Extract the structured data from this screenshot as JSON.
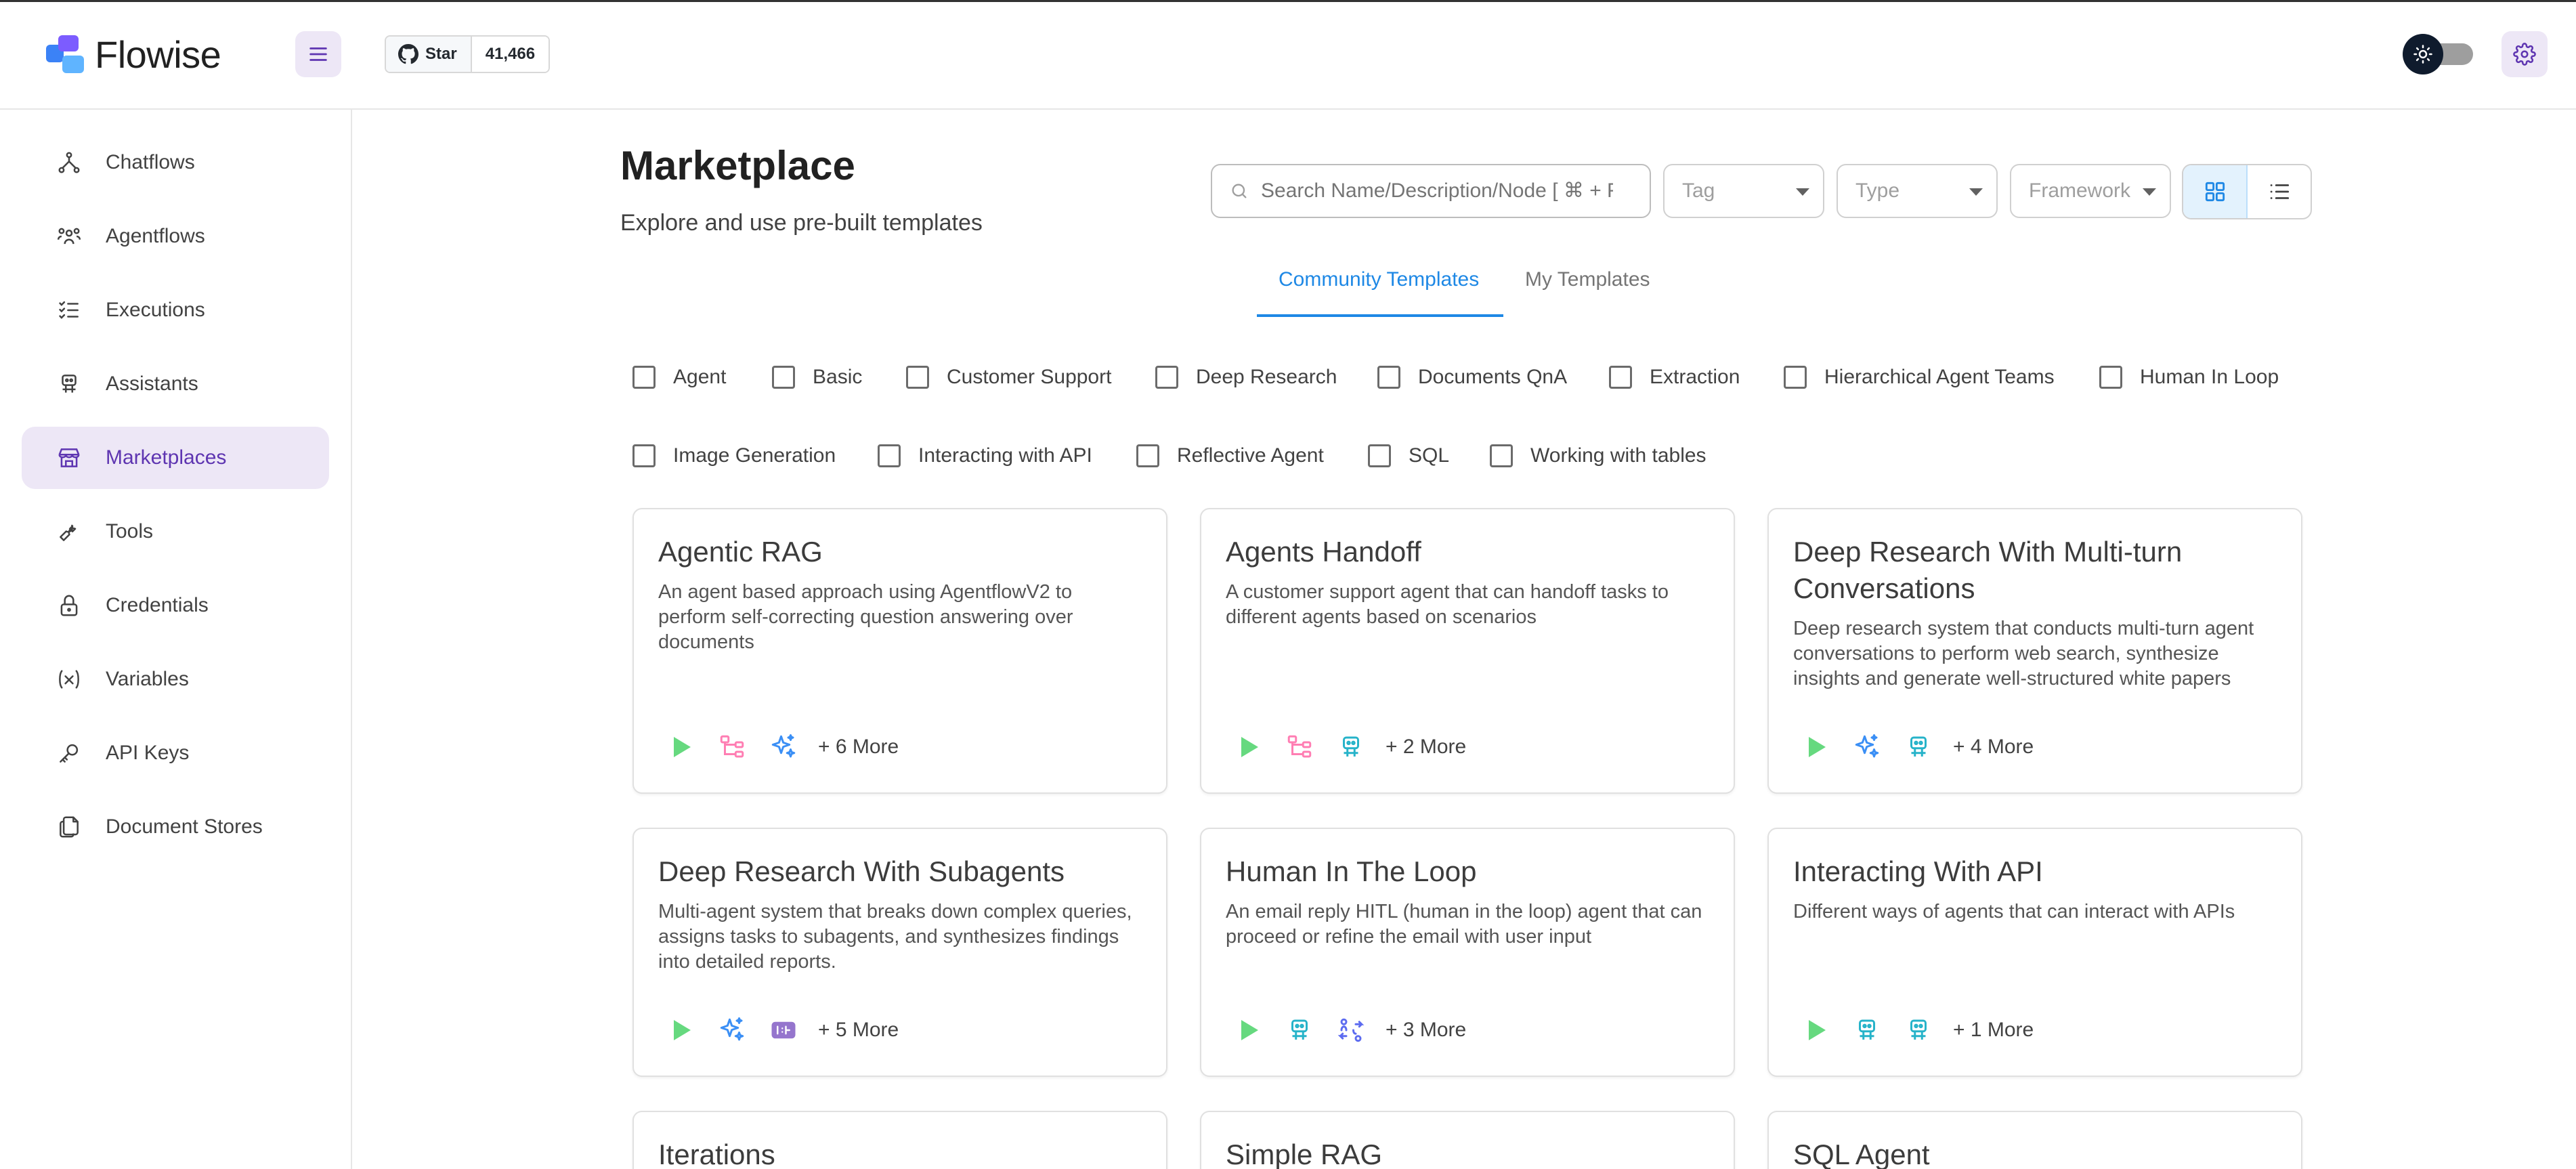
{
  "app": {
    "name": "Flowise"
  },
  "github": {
    "star_label": "Star",
    "star_count": "41,466"
  },
  "sidebar": {
    "items": [
      {
        "label": "Chatflows",
        "icon": "hierarchy-icon"
      },
      {
        "label": "Agentflows",
        "icon": "users-group-icon"
      },
      {
        "label": "Executions",
        "icon": "list-check-icon"
      },
      {
        "label": "Assistants",
        "icon": "robot-icon"
      },
      {
        "label": "Marketplaces",
        "icon": "store-icon",
        "active": true
      },
      {
        "label": "Tools",
        "icon": "wrench-icon"
      },
      {
        "label": "Credentials",
        "icon": "lock-icon"
      },
      {
        "label": "Variables",
        "icon": "variable-icon"
      },
      {
        "label": "API Keys",
        "icon": "key-icon"
      },
      {
        "label": "Document Stores",
        "icon": "files-icon"
      }
    ]
  },
  "main": {
    "title": "Marketplace",
    "subtitle": "Explore and use pre-built templates",
    "search_placeholder": "Search Name/Description/Node [ ⌘ + F ]",
    "filters": {
      "tag": "Tag",
      "type": "Type",
      "framework": "Framework"
    },
    "tabs": [
      {
        "label": "Community Templates",
        "active": true
      },
      {
        "label": "My Templates",
        "active": false
      }
    ],
    "tags": [
      "Agent",
      "Basic",
      "Customer Support",
      "Deep Research",
      "Documents QnA",
      "Extraction",
      "Hierarchical Agent Teams",
      "Human In Loop",
      "Image Generation",
      "Interacting with API",
      "Reflective Agent",
      "SQL",
      "Working with tables"
    ],
    "cards": [
      {
        "title": "Agentic RAG",
        "description": "An agent based approach using AgentflowV2 to perform self-correcting question answering over documents",
        "icons": [
          "play-icon",
          "condition-icon",
          "sparkle-icon"
        ],
        "more": "+ 6 More"
      },
      {
        "title": "Agents Handoff",
        "description": "A customer support agent that can handoff tasks to different agents based on scenarios",
        "icons": [
          "play-icon",
          "condition-icon",
          "robot-icon"
        ],
        "more": "+ 2 More"
      },
      {
        "title": "Deep Research With Multi-turn Conversations",
        "description": "Deep research system that conducts multi-turn agent conversations to perform web search, synthesize insights and generate well-structured white papers",
        "icons": [
          "play-icon",
          "sparkle-icon",
          "robot-icon"
        ],
        "more": "+ 4 More"
      },
      {
        "title": "Deep Research With Subagents",
        "description": "Multi-agent system that breaks down complex queries, assigns tasks to subagents, and synthesizes findings into detailed reports.",
        "icons": [
          "play-icon",
          "sparkle-icon",
          "iteration-icon"
        ],
        "more": "+ 5 More"
      },
      {
        "title": "Human In The Loop",
        "description": "An email reply HITL (human in the loop) agent that can proceed or refine the email with user input",
        "icons": [
          "play-icon",
          "robot-icon",
          "human-input-icon"
        ],
        "more": "+ 3 More"
      },
      {
        "title": "Interacting With API",
        "description": "Different ways of agents that can interact with APIs",
        "icons": [
          "play-icon",
          "robot-icon",
          "robot-icon"
        ],
        "more": "+ 1 More"
      },
      {
        "title": "Iterations"
      },
      {
        "title": "Simple RAG"
      },
      {
        "title": "SQL Agent"
      }
    ]
  },
  "colors": {
    "accent": "#5e35b1",
    "tab_active": "#1e88e5",
    "play": "#66d97f",
    "condition": "#ff7eb3",
    "sparkle": "#3b8ff5",
    "robot": "#26b3c9",
    "iteration": "#9575cd"
  }
}
